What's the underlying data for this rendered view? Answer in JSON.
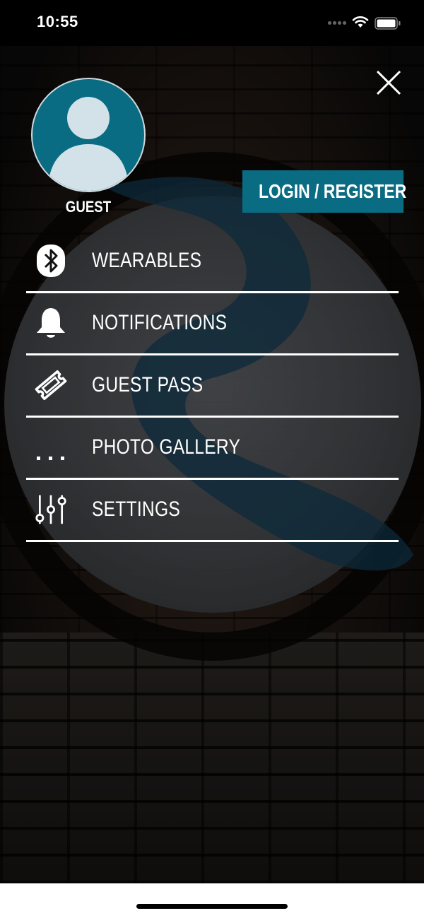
{
  "status_bar": {
    "time": "10:55"
  },
  "profile": {
    "name": "GUEST",
    "avatar_color": "#0a6c82"
  },
  "actions": {
    "login_label": "LOGIN / REGISTER",
    "accent_color": "#0a6c82"
  },
  "menu": {
    "items": [
      {
        "label": "WEARABLES",
        "icon": "bluetooth-icon"
      },
      {
        "label": "NOTIFICATIONS",
        "icon": "bell-icon"
      },
      {
        "label": "GUEST PASS",
        "icon": "ticket-icon"
      },
      {
        "label": "PHOTO GALLERY",
        "icon": "more-dots-icon"
      },
      {
        "label": "SETTINGS",
        "icon": "sliders-icon"
      }
    ]
  }
}
